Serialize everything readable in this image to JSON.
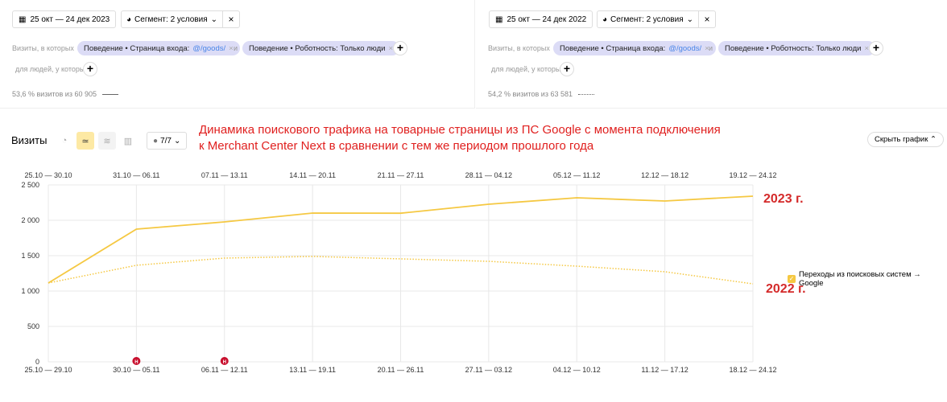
{
  "panels": [
    {
      "date": "25 окт — 24 дек 2023",
      "segment": "Сегмент: 2 условия",
      "visits_label": "Визиты, в которых",
      "chip1_prefix": "Поведение • Страница входа:",
      "chip1_value": "@/goods/",
      "and": "и",
      "chip2": "Поведение • Роботность: Только люди",
      "people_label": "для людей, у которых",
      "stat": "53,6 % визитов из 60 905"
    },
    {
      "date": "25 окт — 24 дек 2022",
      "segment": "Сегмент: 2 условия",
      "visits_label": "Визиты, в которых",
      "chip1_prefix": "Поведение • Страница входа:",
      "chip1_value": "@/goods/",
      "and": "и",
      "chip2": "Поведение • Роботность: Только люди",
      "people_label": "для людей, у которых",
      "stat": "54,2 % визитов из 63 581"
    }
  ],
  "toolbar": {
    "title": "Визиты",
    "comments": "7/7",
    "hide_chart": "Скрыть график"
  },
  "annotation": {
    "line1": "Динамика поискового трафика на товарные страницы из ПС Google с момента подключения",
    "line2": "к Merchant Center Next в сравнении с тем же периодом прошлого года",
    "y2023": "2023 г.",
    "y2022": "2022 г."
  },
  "chart_data": {
    "type": "line",
    "ylim": [
      0,
      2500
    ],
    "yticks": [
      "0",
      "500",
      "1 000",
      "1 500",
      "2 000",
      "2 500"
    ],
    "x_top": [
      "25.10 — 30.10",
      "31.10 — 06.11",
      "07.11 — 13.11",
      "14.11 — 20.11",
      "21.11 — 27.11",
      "28.11 — 04.12",
      "05.12 — 11.12",
      "12.12 — 18.12",
      "19.12 — 24.12"
    ],
    "x_bottom": [
      "25.10 — 29.10",
      "30.10 — 05.11",
      "06.11 — 12.11",
      "13.11 — 19.11",
      "20.11 — 26.11",
      "27.11 — 03.12",
      "04.12 — 10.12",
      "11.12 — 17.12",
      "18.12 — 24.12"
    ],
    "legend": "Переходы из поисковых систем → Google",
    "color": "#f5c842",
    "series": [
      {
        "name": "2023",
        "style": "solid",
        "values": [
          1114,
          1875,
          1977,
          2102,
          2100,
          2227,
          2318,
          2273,
          2341
        ]
      },
      {
        "name": "2022",
        "style": "dotted",
        "values": [
          1114,
          1364,
          1466,
          1489,
          1455,
          1420,
          1352,
          1273,
          1102
        ]
      }
    ],
    "markers": [
      {
        "index": 1,
        "label": "Н"
      },
      {
        "index": 2,
        "label": "Н"
      }
    ]
  }
}
